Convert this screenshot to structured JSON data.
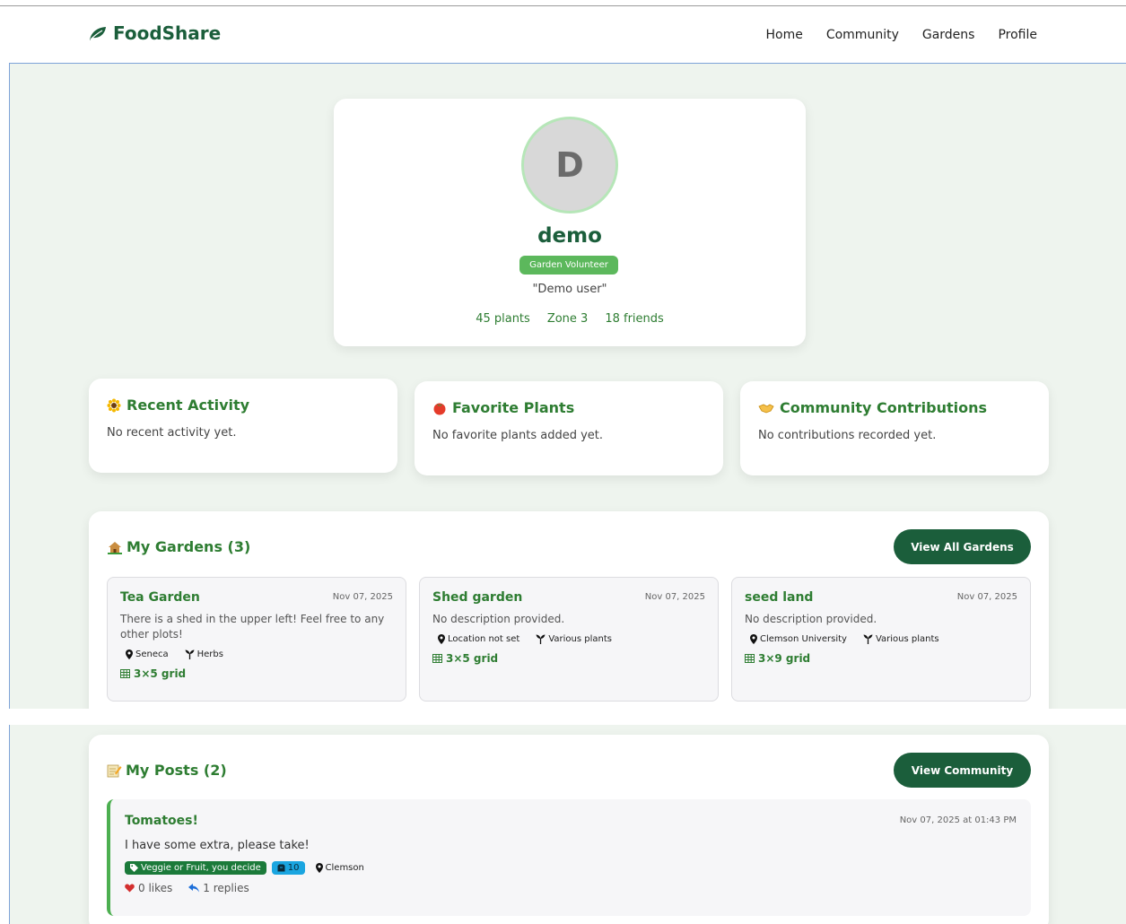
{
  "nav": {
    "brand": "FoodShare",
    "links": [
      "Home",
      "Community",
      "Gardens",
      "Profile"
    ]
  },
  "profile": {
    "initial": "D",
    "username": "demo",
    "role": "Garden Volunteer",
    "bio": "\"Demo user\"",
    "stats": [
      "45 plants",
      "Zone 3",
      "18 friends"
    ]
  },
  "info_cards": [
    {
      "icon": "sunflower-icon",
      "title": "Recent Activity",
      "text": "No recent activity yet."
    },
    {
      "icon": "tomato-icon",
      "title": "Favorite Plants",
      "text": "No favorite plants added yet."
    },
    {
      "icon": "handshake-icon",
      "title": "Community Contributions",
      "text": "No contributions recorded yet."
    }
  ],
  "gardens": {
    "title": "My Gardens (3)",
    "button": "View All Gardens",
    "items": [
      {
        "name": "Tea Garden",
        "date": "Nov 07, 2025",
        "desc": "There is a shed in the upper left! Feel free to any other plots!",
        "location": "Seneca",
        "plants": "Herbs",
        "grid": "3×5 grid"
      },
      {
        "name": "Shed garden",
        "date": "Nov 07, 2025",
        "desc": "No description provided.",
        "location": "Location not set",
        "plants": "Various plants",
        "grid": "3×5 grid"
      },
      {
        "name": "seed land",
        "date": "Nov 07, 2025",
        "desc": "No description provided.",
        "location": "Clemson University",
        "plants": "Various plants",
        "grid": "3×9 grid"
      }
    ]
  },
  "posts": {
    "title": "My Posts (2)",
    "button": "View Community",
    "items": [
      {
        "title": "Tomatoes!",
        "date": "Nov 07, 2025 at 01:43 PM",
        "body": "I have some extra, please take!",
        "category": "Veggie or Fruit, you decide",
        "quantity": "10",
        "location": "Clemson",
        "likes": "0 likes",
        "replies": "1 replies"
      }
    ]
  },
  "colors": {
    "brand": "#1b5e3b",
    "accent": "#2e7d32",
    "badge": "#5cb85c",
    "background": "#eef4ee"
  }
}
